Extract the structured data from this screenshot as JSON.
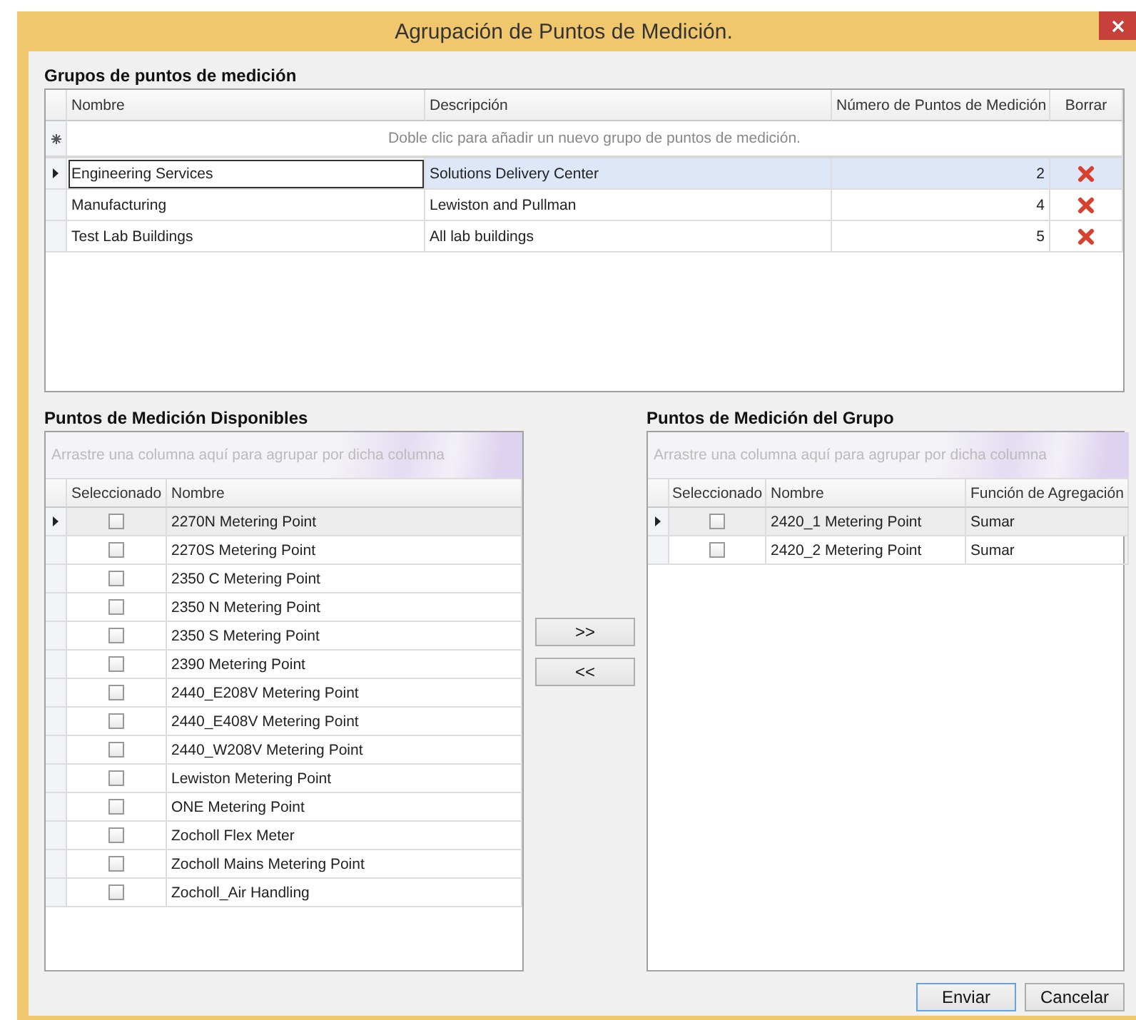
{
  "window": {
    "title": "Agrupación de Puntos de Medición."
  },
  "groups": {
    "heading": "Grupos de puntos de medición",
    "columns": [
      "Nombre",
      "Descripción",
      "Número de Puntos de Medición",
      "Borrar"
    ],
    "new_row_hint": "Doble clic para añadir un nuevo grupo de puntos de medición.",
    "rows": [
      {
        "name": "Engineering Services",
        "description": "Solutions Delivery Center",
        "count": "2",
        "current": true,
        "selected": true
      },
      {
        "name": "Manufacturing",
        "description": "Lewiston and Pullman",
        "count": "4",
        "current": false,
        "selected": false
      },
      {
        "name": "Test Lab Buildings",
        "description": "All lab buildings",
        "count": "5",
        "current": false,
        "selected": false
      }
    ]
  },
  "available": {
    "heading": "Puntos de Medición Disponibles",
    "group_panel_hint": "Arrastre una columna aquí para agrupar por dicha columna",
    "columns": [
      "Seleccionado",
      "Nombre"
    ],
    "rows": [
      {
        "name": "2270N Metering Point",
        "checked": false,
        "current": true
      },
      {
        "name": "2270S Metering Point",
        "checked": false,
        "current": false
      },
      {
        "name": "2350 C Metering Point",
        "checked": false,
        "current": false
      },
      {
        "name": "2350 N Metering Point",
        "checked": false,
        "current": false
      },
      {
        "name": "2350 S Metering Point",
        "checked": false,
        "current": false
      },
      {
        "name": "2390 Metering Point",
        "checked": false,
        "current": false
      },
      {
        "name": "2440_E208V Metering Point",
        "checked": false,
        "current": false
      },
      {
        "name": "2440_E408V Metering Point",
        "checked": false,
        "current": false
      },
      {
        "name": "2440_W208V Metering Point",
        "checked": false,
        "current": false
      },
      {
        "name": "Lewiston Metering Point",
        "checked": false,
        "current": false
      },
      {
        "name": "ONE Metering Point",
        "checked": false,
        "current": false
      },
      {
        "name": "Zocholl Flex Meter",
        "checked": false,
        "current": false
      },
      {
        "name": "Zocholl Mains Metering Point",
        "checked": false,
        "current": false
      },
      {
        "name": "Zocholl_Air Handling",
        "checked": false,
        "current": false
      }
    ]
  },
  "transfer_buttons": [
    ">>",
    "<<"
  ],
  "group_points": {
    "heading": "Puntos de Medición del Grupo",
    "group_panel_hint": "Arrastre una columna aquí para agrupar por dicha columna",
    "columns": [
      "Seleccionado",
      "Nombre",
      "Función de Agregación"
    ],
    "rows": [
      {
        "name": "2420_1 Metering Point",
        "function": "Sumar",
        "checked": false,
        "current": true
      },
      {
        "name": "2420_2 Metering Point",
        "function": "Sumar",
        "checked": false,
        "current": false
      }
    ]
  },
  "buttons": [
    {
      "label": "Enviar",
      "default": true
    },
    {
      "label": "Cancelar",
      "default": false
    }
  ]
}
